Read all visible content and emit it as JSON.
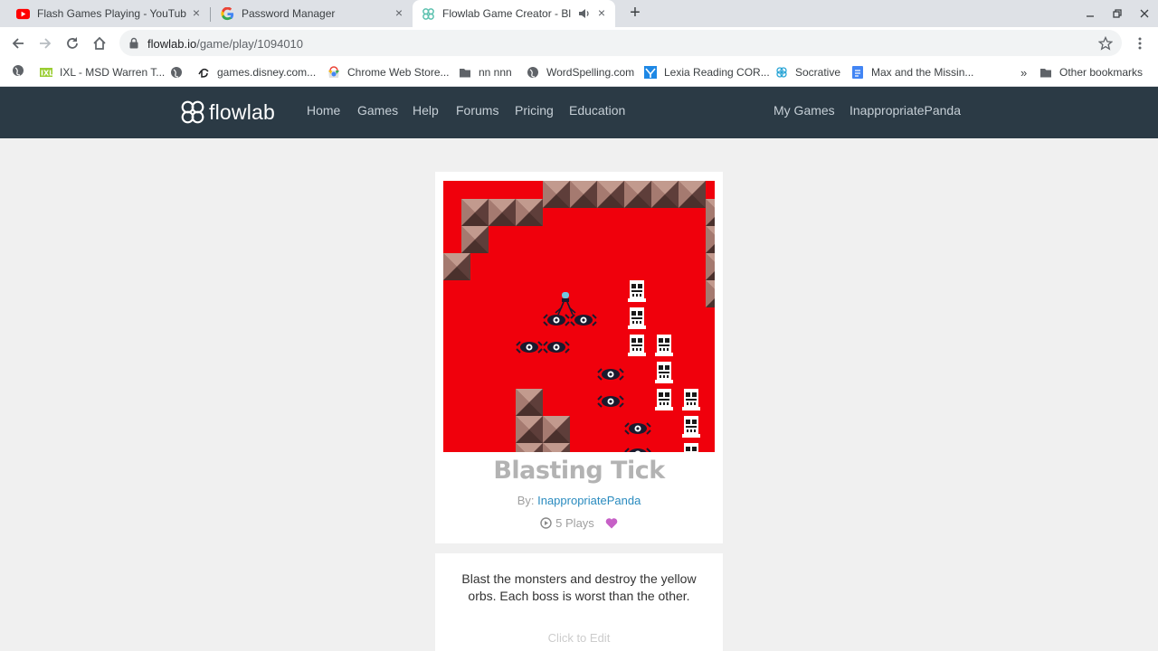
{
  "browser": {
    "tabs": [
      {
        "title": "Flash Games Playing - YouTube",
        "icon": "youtube-icon"
      },
      {
        "title": "Password Manager",
        "icon": "google-icon"
      },
      {
        "title": "Flowlab Game Creator - Blas",
        "icon": "flowlab-icon",
        "active": true,
        "audio": true
      }
    ],
    "url_host": "flowlab.io",
    "url_path": "/game/play/1094010",
    "bookmarks": [
      {
        "label": "IXL - MSD Warren T...",
        "icon": "ixl-icon"
      },
      {
        "label": "games.disney.com...",
        "icon": "disney-icon"
      },
      {
        "label": "Chrome Web Store...",
        "icon": "chrome-web-store-icon"
      },
      {
        "label": "nn nnn",
        "icon": "folder-icon"
      },
      {
        "label": "WordSpelling.com",
        "icon": "globe-icon"
      },
      {
        "label": "Lexia Reading COR...",
        "icon": "lexia-icon"
      },
      {
        "label": "Socrative",
        "icon": "socrative-icon"
      },
      {
        "label": "Max and the Missin...",
        "icon": "docs-icon"
      }
    ],
    "more_bookmarks": "»",
    "other_bookmarks": "Other bookmarks"
  },
  "site": {
    "logo_text": "flowlab",
    "nav_links": [
      "Home",
      "Games",
      "Help",
      "Forums",
      "Pricing",
      "Education"
    ],
    "right_links": [
      "My Games",
      "InappropriatePanda"
    ]
  },
  "game": {
    "title": "Blasting Tick",
    "by_label": "By:",
    "author": "InappropriatePanda",
    "plays": "5 Plays",
    "description": "Blast the monsters and destroy the yellow orbs. Each boss is worst than the other.",
    "edit_label": "Click to Edit"
  },
  "colors": {
    "nav_bg": "#2b3a45",
    "game_bg": "#f0000c",
    "author_link": "#2a8bbf",
    "heart": "#c660c6"
  }
}
